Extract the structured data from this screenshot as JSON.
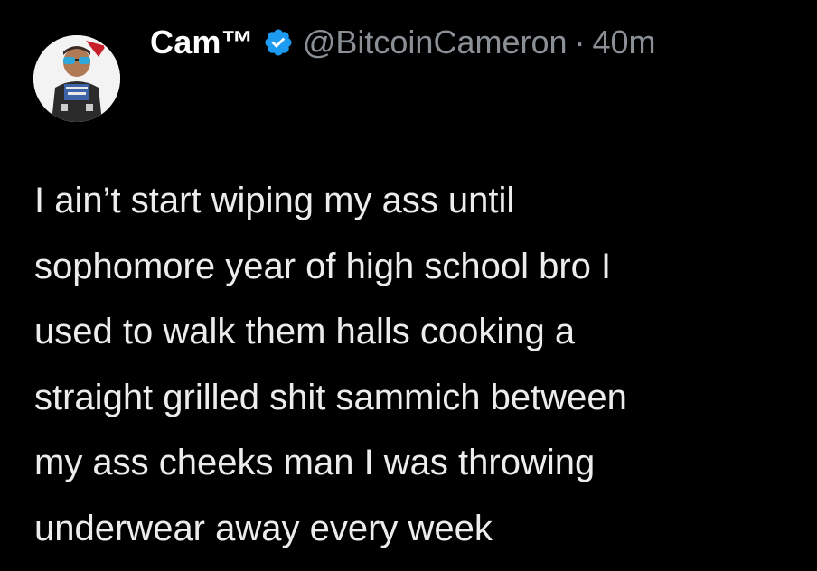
{
  "tweet": {
    "display_name": "Cam™",
    "handle": "@BitcoinCameron",
    "separator": "·",
    "time": "40m",
    "verified_icon": "verified-badge-icon",
    "text_lines": [
      "I ain’t start wiping my ass until",
      "sophomore year of high school bro I",
      "used to walk them halls cooking a",
      "straight grilled shit sammich between",
      "my ass cheeks man I was throwing",
      "underwear away every week"
    ]
  },
  "colors": {
    "background": "#000000",
    "name": "#ffffff",
    "secondary": "#8b9096",
    "verified": "#1d9bf0",
    "text": "#ececec"
  }
}
